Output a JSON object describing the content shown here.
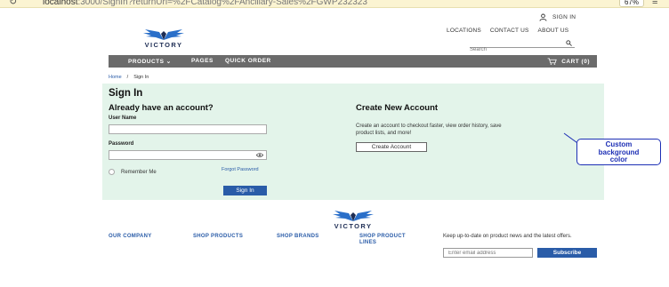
{
  "browser": {
    "url_host": "localhost",
    "url_rest": ":3000/SignIn?returnUrl=%2FCatalog%2FAncillary-Sales%2FGWP232323",
    "zoom": "67%",
    "reload_icon": "reload-icon",
    "menu_icon": "menu-icon"
  },
  "header": {
    "signin_label": "SIGN IN",
    "brand": "VICTORY",
    "util_nav": [
      "LOCATIONS",
      "CONTACT US",
      "ABOUT US"
    ],
    "search_placeholder": "Search"
  },
  "mainnav": {
    "products": "PRODUCTS ⌄",
    "pages": "PAGES",
    "quick_order": "QUICK ORDER",
    "cart": "CART (0)"
  },
  "breadcrumb": {
    "home": "Home",
    "separator": "/",
    "current": "Sign In"
  },
  "signin": {
    "title": "Sign In",
    "subtitle": "Already have an account?",
    "username_label": "User Name",
    "password_label": "Password",
    "remember_label": "Remember Me",
    "forgot_label": "Forgot Password",
    "submit_label": "Sign In"
  },
  "create": {
    "title": "Create New Account",
    "description": "Create an account to checkout faster, view order history, save product lists, and more!",
    "button_label": "Create Account"
  },
  "callout": {
    "line1": "Custom",
    "line2": "background",
    "line3": "color"
  },
  "footer": {
    "brand": "VICTORY",
    "col1": "OUR COMPANY",
    "col2": "SHOP PRODUCTS",
    "col3": "SHOP BRANDS",
    "col4_line1": "SHOP PRODUCT",
    "col4_line2": "LINES",
    "newsletter_text": "Keep up-to-date on product news and the latest offers.",
    "email_placeholder": "Enter email address",
    "subscribe_label": "Subscribe"
  },
  "colors": {
    "accent": "#2a5ca8",
    "panel_bg": "#e3f4ea",
    "nav_bg": "#6b6b6b",
    "callout": "#1d2fb5"
  }
}
